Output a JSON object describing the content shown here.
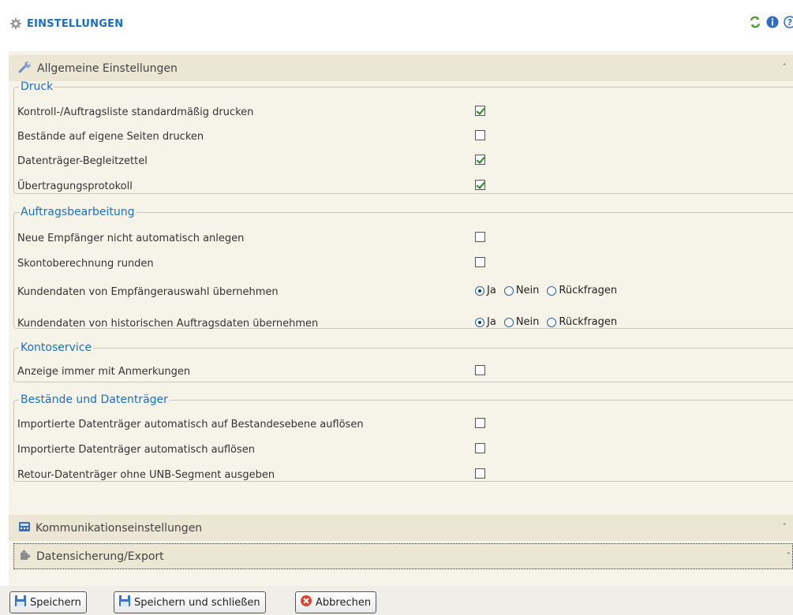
{
  "header": {
    "title": "EINSTELLUNGEN"
  },
  "icons": {
    "settings": "gear-icon",
    "refresh": "refresh-icon",
    "info": "info-icon",
    "help": "help-icon"
  },
  "sections": {
    "general": {
      "label": "Allgemeine Einstellungen"
    },
    "communication": {
      "label": "Kommunikationseinstellungen"
    },
    "backup": {
      "label": "Datensicherung/Export"
    }
  },
  "groups": {
    "druck": {
      "legend": "Druck",
      "rows": [
        {
          "label": "Kontroll-/Auftragsliste standardmäßig drucken",
          "checked": true
        },
        {
          "label": "Bestände auf eigene Seiten drucken",
          "checked": false
        },
        {
          "label": "Datenträger-Begleitzettel",
          "checked": true
        },
        {
          "label": "Übertragungsprotokoll",
          "checked": true
        }
      ]
    },
    "auftrag": {
      "legend": "Auftragsbearbeitung",
      "rows": [
        {
          "label": "Neue Empfänger nicht automatisch anlegen",
          "checked": false
        },
        {
          "label": "Skontoberechnung runden",
          "checked": false
        },
        {
          "label": "Kundendaten von Empfängerauswahl übernehmen",
          "selected": "Ja"
        },
        {
          "label": "Kundendaten von historischen Auftragsdaten übernehmen",
          "selected": "Ja"
        }
      ],
      "options": [
        "Ja",
        "Nein",
        "Rückfragen"
      ]
    },
    "konto": {
      "legend": "Kontoservice",
      "rows": [
        {
          "label": "Anzeige immer mit Anmerkungen",
          "checked": false
        }
      ]
    },
    "bestaende": {
      "legend": "Bestände und Datenträger",
      "rows": [
        {
          "label": "Importierte Datenträger automatisch auf Bestandesebene auflösen",
          "checked": false
        },
        {
          "label": "Importierte Datenträger automatisch auflösen",
          "checked": false
        },
        {
          "label": "Retour-Datenträger ohne UNB-Segment ausgeben",
          "checked": false
        }
      ]
    }
  },
  "buttons": {
    "save": "Speichern",
    "save_close": "Speichern und schließen",
    "cancel": "Abbrechen"
  },
  "colors": {
    "accent": "#1a6fc4",
    "panel": "#f6f3e9",
    "header": "#ece6d5",
    "check": "#1d8a1d"
  }
}
